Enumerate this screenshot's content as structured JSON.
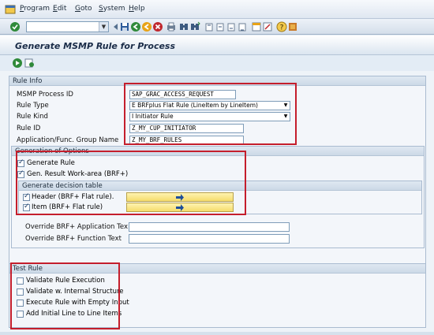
{
  "menu": {
    "items": [
      {
        "underline": "P",
        "rest": "rogram"
      },
      {
        "underline": "E",
        "rest": "dit"
      },
      {
        "underline": "G",
        "rest": "oto"
      },
      {
        "underline": "S",
        "rest": "ystem"
      },
      {
        "underline": "H",
        "rest": "elp"
      }
    ]
  },
  "toolbar": {
    "command_field_value": ""
  },
  "title": "Generate MSMP Rule for Process",
  "rule_info": {
    "section_title": "Rule Info",
    "process_id_label": "MSMP Process ID",
    "process_id_value": "SAP_GRAC_ACCESS_REQUEST",
    "rule_type_label": "Rule Type",
    "rule_type_value": "E BRFplus Flat Rule (LineItem by LineItem)",
    "rule_kind_label": "Rule Kind",
    "rule_kind_value": "I Initiator Rule",
    "rule_id_label": "Rule ID",
    "rule_id_value": "Z_MY_CUP_INITIATOR",
    "app_group_label": "Application/Func. Group Name",
    "app_group_value": "Z_MY_BRF_RULES"
  },
  "generation": {
    "section_title": "Generation of Options",
    "generate_rule_label": "Generate Rule",
    "generate_rule_checked": true,
    "gen_result_label": "Gen. Result Work-area (BRF+)",
    "gen_result_checked": true,
    "decision_table_title": "Generate decision table",
    "header_label": "Header (BRF+ Flat rule).",
    "header_checked": true,
    "item_label": "Item  (BRF+ Flat rule)",
    "item_checked": true,
    "override_app_label": "Override BRF+ Application Tex",
    "override_app_value": "",
    "override_func_label": "Override BRF+ Function Text",
    "override_func_value": ""
  },
  "test_rule": {
    "section_title": "Test Rule",
    "options": [
      {
        "label": "Validate Rule Execution",
        "checked": false
      },
      {
        "label": "Validate w. Internal Structure",
        "checked": false
      },
      {
        "label": "Execute Rule with Empty Input",
        "checked": false
      },
      {
        "label": "Add Initial Line to Line Items",
        "checked": false
      }
    ]
  },
  "colors": {
    "highlight_box": "#c41e2c",
    "button_yellow": "#f5dc6a"
  }
}
